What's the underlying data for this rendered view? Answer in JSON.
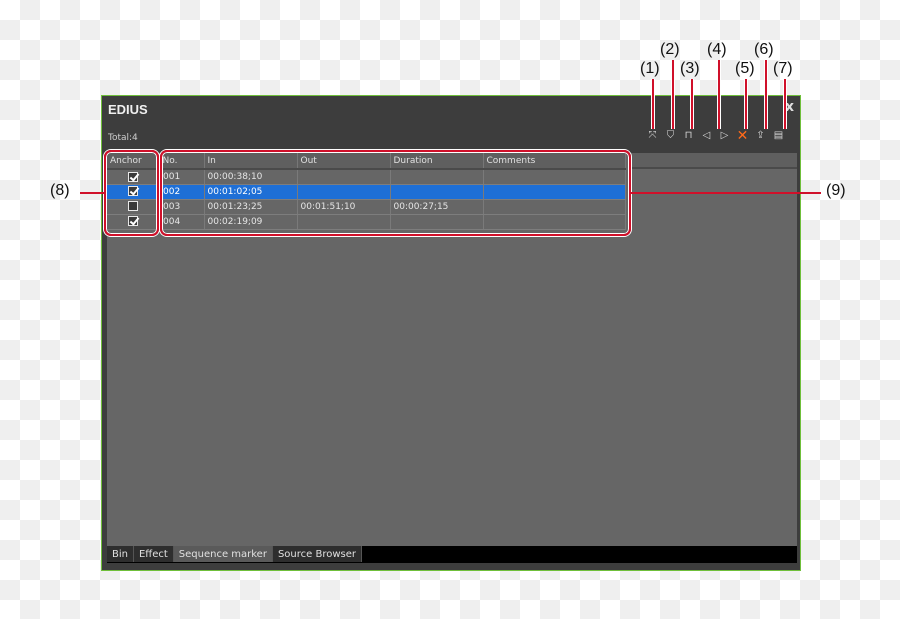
{
  "window": {
    "title": "EDIUS",
    "close_label": "x",
    "total_label": "Total:4"
  },
  "toolbar": {
    "buttons": [
      {
        "name": "clear-marker",
        "glyph": "⤧"
      },
      {
        "name": "set-marker",
        "glyph": "⛉"
      },
      {
        "name": "set-in-out-marker",
        "glyph": "⊓"
      },
      {
        "name": "prev-marker",
        "glyph": "◁"
      },
      {
        "name": "next-marker",
        "glyph": "▷"
      },
      {
        "name": "delete-marker",
        "glyph": "✕"
      },
      {
        "name": "import-marker",
        "glyph": "⇪"
      },
      {
        "name": "export-marker",
        "glyph": "▤"
      }
    ]
  },
  "table": {
    "columns": [
      "Anchor",
      "No.",
      "In",
      "Out",
      "Duration",
      "Comments"
    ],
    "rows": [
      {
        "anchor": true,
        "no": "001",
        "in": "00:00:38;10",
        "out": "",
        "duration": "",
        "comments": "",
        "selected": false
      },
      {
        "anchor": true,
        "no": "002",
        "in": "00:01:02;05",
        "out": "",
        "duration": "",
        "comments": "",
        "selected": true
      },
      {
        "anchor": false,
        "no": "003",
        "in": "00:01:23;25",
        "out": "00:01:51;10",
        "duration": "00:00:27;15",
        "comments": "",
        "selected": false
      },
      {
        "anchor": true,
        "no": "004",
        "in": "00:02:19;09",
        "out": "",
        "duration": "",
        "comments": "",
        "selected": false
      }
    ]
  },
  "tabs": [
    {
      "label": "Bin",
      "active": false
    },
    {
      "label": "Effect",
      "active": false
    },
    {
      "label": "Sequence marker",
      "active": true
    },
    {
      "label": "Source Browser",
      "active": false
    }
  ],
  "callouts": {
    "c1": "(1)",
    "c2": "(2)",
    "c3": "(3)",
    "c4": "(4)",
    "c5": "(5)",
    "c6": "(6)",
    "c7": "(7)",
    "c8": "(8)",
    "c9": "(9)"
  },
  "colors": {
    "accent_selected": "#1e6fd6",
    "callout_red": "#d0102a",
    "delete_orange": "#ff6a1a",
    "panel_border": "#6fbf3a"
  }
}
